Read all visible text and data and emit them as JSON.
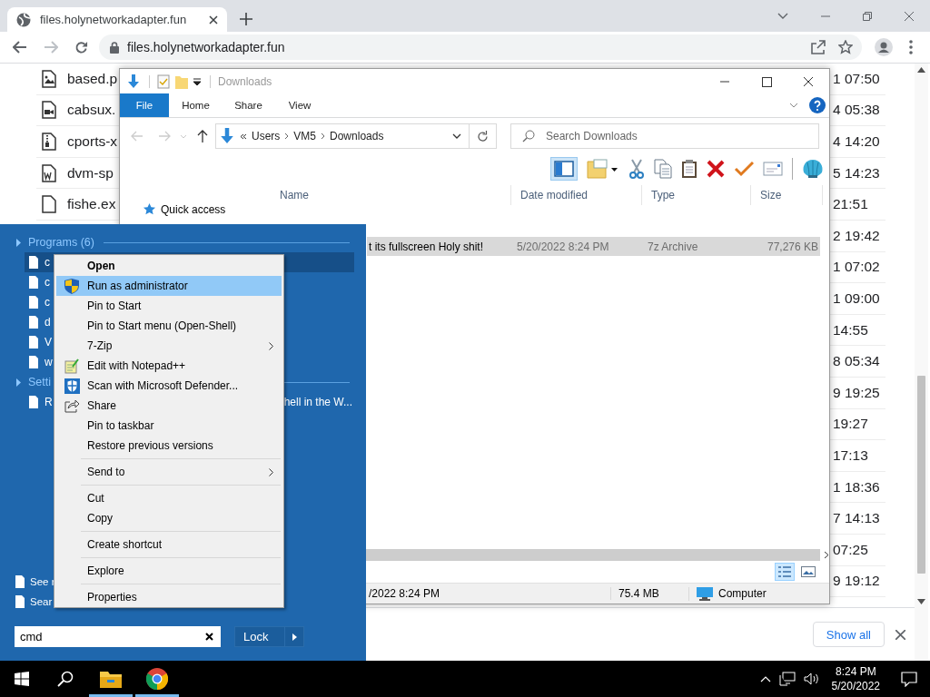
{
  "browser": {
    "tab": {
      "title": "files.holynetworkadapter.fun"
    },
    "url": "files.holynetworkadapter.fun",
    "files": [
      {
        "kind": "image",
        "name": "based.p",
        "time": "1 07:50"
      },
      {
        "kind": "video",
        "name": "cabsux.",
        "time": "4 05:38"
      },
      {
        "kind": "archive",
        "name": "cports-x",
        "time": "4 14:20"
      },
      {
        "kind": "document",
        "name": "dvm-sp",
        "time": "5 14:23"
      },
      {
        "kind": "file",
        "name": "fishe.ex",
        "time": "21:51"
      },
      {
        "time": "2 19:42"
      },
      {
        "time": "1 07:02"
      },
      {
        "time": "1 09:00"
      },
      {
        "time": "14:55"
      },
      {
        "time": "8 05:34"
      },
      {
        "time": "9 19:25"
      },
      {
        "time": "19:27"
      },
      {
        "time": "17:13"
      },
      {
        "time": "1 18:36"
      },
      {
        "time": "7 14:13"
      },
      {
        "time": "07:25"
      },
      {
        "time": "9 19:12"
      }
    ],
    "download_bar": {
      "button": "Show all"
    }
  },
  "explorer": {
    "title": "Downloads",
    "ribbon_tabs": [
      {
        "label": "File",
        "selected": true
      },
      {
        "label": "Home",
        "selected": false
      },
      {
        "label": "Share",
        "selected": false
      },
      {
        "label": "View",
        "selected": false
      }
    ],
    "breadcrumb": [
      "Users",
      "VM5",
      "Downloads"
    ],
    "search": {
      "placeholder": "Search Downloads"
    },
    "toolbar": [
      {
        "kind": "pane",
        "on": true
      },
      {
        "kind": "folder"
      },
      {
        "kind": "cut"
      },
      {
        "kind": "copy"
      },
      {
        "kind": "paste"
      },
      {
        "kind": "delete"
      },
      {
        "kind": "select"
      },
      {
        "kind": "properties"
      },
      {
        "kind": "separator"
      },
      {
        "kind": "shell"
      }
    ],
    "nav": [
      "Quick access"
    ],
    "columns": [
      "Name",
      "Date modified",
      "Type",
      "Size"
    ],
    "rows": [
      {
        "name": "t its fullscreen Holy shit!",
        "date": "5/20/2022 8:24 PM",
        "type": "7z Archive",
        "size": "77,276 KB",
        "selected": true
      }
    ],
    "view_buttons": [
      {
        "kind": "details",
        "selected": true
      },
      {
        "kind": "thumbnails",
        "selected": false
      }
    ],
    "status_bar": [
      "/2022 8:24 PM",
      "75.4 MB",
      "Computer"
    ]
  },
  "start_menu": {
    "sections": [
      {
        "title": "Programs (6)",
        "items": [
          {
            "label": "c",
            "selected": true
          },
          {
            "label": "c",
            "selected": false
          },
          {
            "label": "c",
            "selected": false
          },
          {
            "label": "d",
            "selected": false
          },
          {
            "label": "V",
            "selected": false
          },
          {
            "label": "w",
            "selected": false
          }
        ]
      },
      {
        "title": "Setti",
        "items": [
          {
            "label": "R",
            "label_end": "hell in the W...",
            "selected": false
          }
        ]
      }
    ],
    "links": [
      "See r",
      "Sear"
    ],
    "search": {
      "value": "cmd"
    },
    "power_button": "Lock"
  },
  "context_menu": {
    "groups": [
      [
        {
          "label": "Open",
          "kind": "default",
          "selected": false
        },
        {
          "label": "Run as administrator",
          "kind": "admin",
          "selected": true
        },
        {
          "label": "Pin to Start",
          "kind": "command",
          "selected": false
        },
        {
          "label": "Pin to Start menu (Open-Shell)",
          "kind": "command",
          "selected": false
        },
        {
          "label": "7-Zip",
          "kind": "submenu",
          "selected": false
        },
        {
          "label": "Edit with Notepad++",
          "kind": "editor",
          "selected": false
        },
        {
          "label": "Scan with Microsoft Defender...",
          "kind": "scan",
          "selected": false
        },
        {
          "label": "Share",
          "kind": "share",
          "selected": false
        },
        {
          "label": "Pin to taskbar",
          "kind": "command",
          "selected": false
        },
        {
          "label": "Restore previous versions",
          "kind": "command",
          "selected": false
        }
      ],
      [
        {
          "label": "Send to",
          "kind": "submenu",
          "selected": false
        }
      ],
      [
        {
          "label": "Cut",
          "kind": "command",
          "selected": false
        },
        {
          "label": "Copy",
          "kind": "command",
          "selected": false
        }
      ],
      [
        {
          "label": "Create shortcut",
          "kind": "command",
          "selected": false
        }
      ],
      [
        {
          "label": "Explore",
          "kind": "command",
          "selected": false
        }
      ],
      [
        {
          "label": "Properties",
          "kind": "command",
          "selected": false
        }
      ]
    ]
  },
  "taskbar": {
    "clock": {
      "time": "8:24 PM",
      "date": "5/20/2022"
    }
  }
}
